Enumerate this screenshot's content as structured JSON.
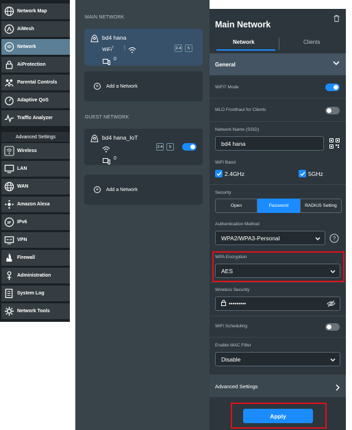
{
  "sidebar": {
    "items": [
      {
        "label": "Network Map",
        "icon": "globe-icon"
      },
      {
        "label": "AiMesh",
        "icon": "aimesh-icon"
      },
      {
        "label": "Network",
        "icon": "network-icon",
        "active": true
      },
      {
        "label": "AiProtection",
        "icon": "lock-icon"
      },
      {
        "label": "Parental Controls",
        "icon": "family-icon"
      },
      {
        "label": "Adaptive QoS",
        "icon": "qos-icon"
      },
      {
        "label": "Traffic Analyzer",
        "icon": "analyzer-icon"
      }
    ],
    "advanced_header": "Advanced Settings",
    "advanced_items": [
      {
        "label": "Wireless",
        "icon": "wifi-icon"
      },
      {
        "label": "LAN",
        "icon": "lan-icon"
      },
      {
        "label": "WAN",
        "icon": "wan-globe-icon"
      },
      {
        "label": "Amazon Alexa",
        "icon": "alexa-icon"
      },
      {
        "label": "IPv6",
        "icon": "ipv6-icon"
      },
      {
        "label": "VPN",
        "icon": "vpn-icon"
      },
      {
        "label": "Firewall",
        "icon": "firewall-icon"
      },
      {
        "label": "Administration",
        "icon": "admin-icon"
      },
      {
        "label": "System Log",
        "icon": "log-icon"
      },
      {
        "label": "Network Tools",
        "icon": "tools-icon"
      }
    ]
  },
  "middle": {
    "main_label": "MAIN NETWORK",
    "main_card": {
      "name": "bd4 hana",
      "wifi_label": "WiFi",
      "wifi_ver": "7",
      "band1": "2.4",
      "band2": "5",
      "clients": "0"
    },
    "add_label": "Add a Network",
    "guest_label": "GUEST NETWORK",
    "guest_card": {
      "name": "bd4 hana_IoT",
      "band1": "2.4",
      "band2": "5",
      "clients": "0"
    }
  },
  "panel": {
    "title": "Main Network",
    "tab_network": "Network",
    "tab_clients": "Clients",
    "general": "General",
    "wifi7_mode": "WiFi7 Mode",
    "mlo": "MLO Fronthaul for Clients",
    "ssid_label": "Network Name (SSID)",
    "ssid_value": "bd4 hana",
    "band_label": "WiFi Band",
    "band_24": "2.4GHz",
    "band_5": "5GHz",
    "security_label": "Security",
    "sec_open": "Open",
    "sec_password": "Password",
    "sec_radius": "RADIUS Setting",
    "auth_label": "Authentication Method",
    "auth_value": "WPA2/WPA3-Personal",
    "wpa_label": "WPA Encryption",
    "wpa_value": "AES",
    "ws_label": "Wireless Security",
    "ws_value": "•••••••••",
    "sched_label": "WiFi Scheduling",
    "mac_label": "Enable MAC Filter",
    "mac_value": "Disable",
    "adv_label": "Advanced Settings",
    "apply": "Apply"
  },
  "colors": {
    "accent": "#1a8cff",
    "highlight": "#e0101a",
    "active_nav": "#5b7f94"
  }
}
